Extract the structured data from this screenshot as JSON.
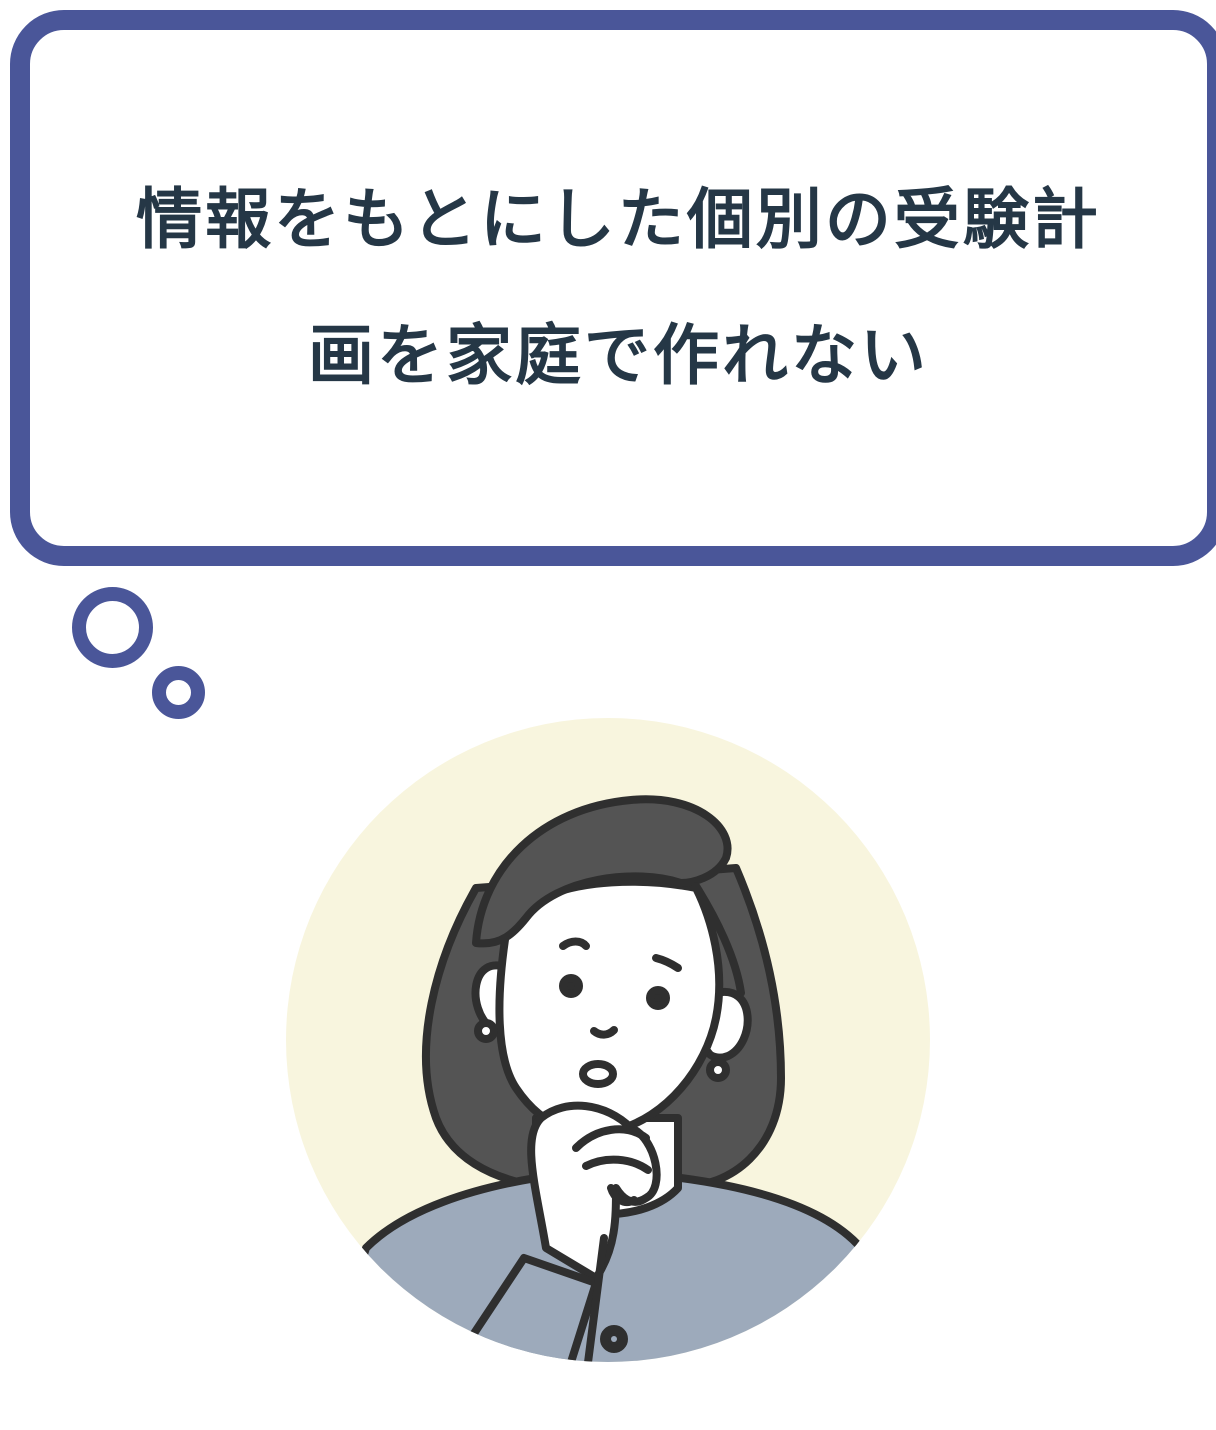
{
  "speech_bubble": {
    "line1": "情報をもとにした個別の受験計",
    "line2": "画を家庭で作れない"
  },
  "colors": {
    "bubble_border": "#4a5699",
    "text": "#253746",
    "portrait_background": "#f8f5de",
    "hair": "#545454",
    "jacket": "#9daabb",
    "outline": "#2f2f2f",
    "skin": "#ffffff"
  },
  "illustration": {
    "subject": "thinking-woman-icon"
  }
}
